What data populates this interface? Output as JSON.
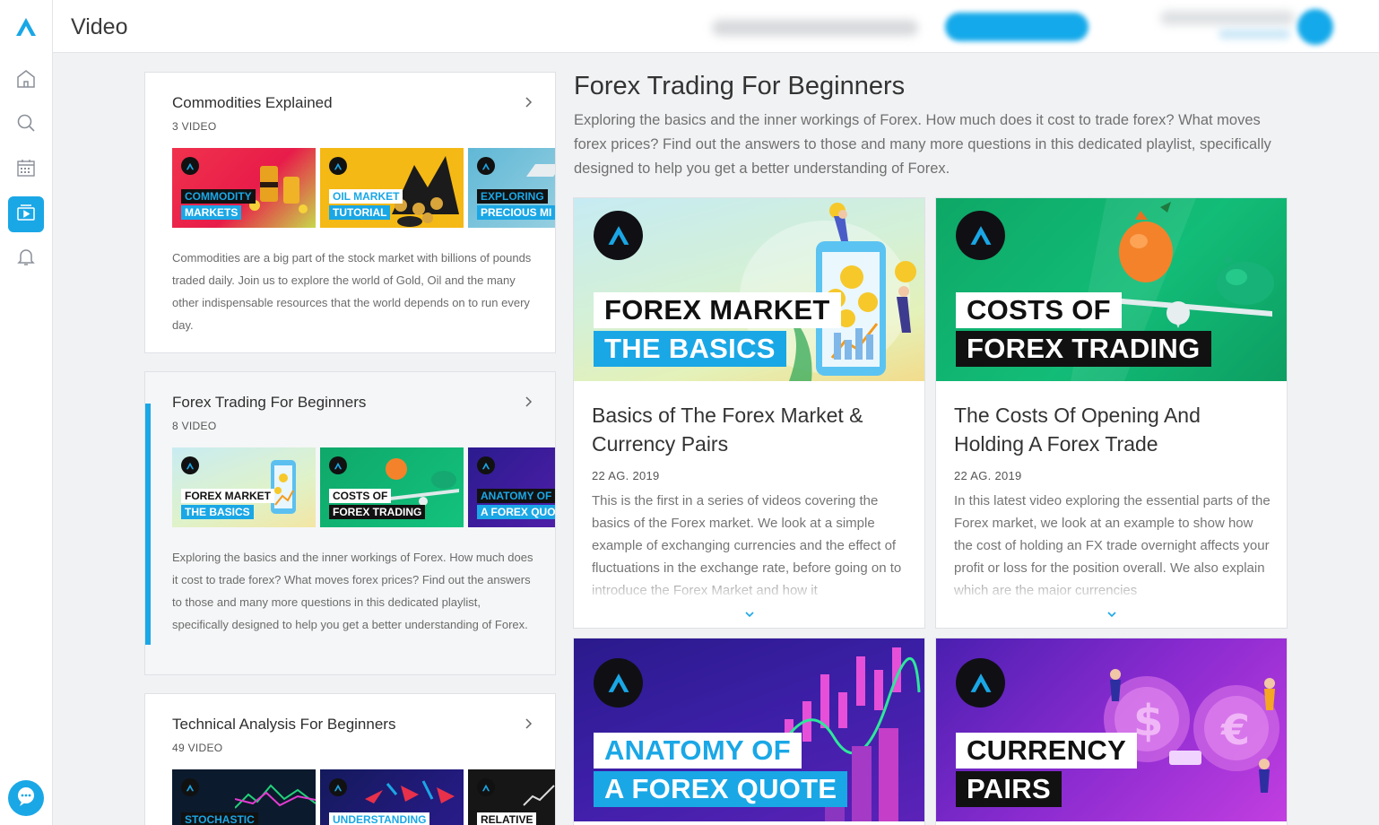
{
  "app": {
    "page_title": "Video",
    "accent": "#1aa7e6"
  },
  "nav": [
    {
      "name": "home-icon"
    },
    {
      "name": "search-icon"
    },
    {
      "name": "calendar-icon"
    },
    {
      "name": "video-icon",
      "active": true
    },
    {
      "name": "bell-icon"
    }
  ],
  "playlists": [
    {
      "title": "Commodities Explained",
      "count": "3 VIDEO",
      "description": "Commodities are a big part of the stock market with billions of pounds traded daily. Join us to explore the world of Gold, Oil and the many other indispensable resources that the world depends on to run every day.",
      "thumbs": [
        {
          "line1": "COMMODITY",
          "line2": "MARKETS"
        },
        {
          "line1": "OIL MARKET",
          "line2": "TUTORIAL"
        },
        {
          "line1": "EXPLORING",
          "line2": "PRECIOUS MI"
        }
      ]
    },
    {
      "title": "Forex Trading For Beginners",
      "count": "8 VIDEO",
      "description": "Exploring the basics and the inner workings of Forex. How much does it cost to trade forex? What moves forex prices? Find out the answers to those and many more questions in this dedicated playlist, specifically designed to help you get a better understanding of Forex.",
      "thumbs": [
        {
          "line1": "FOREX MARKET",
          "line2": "THE BASICS"
        },
        {
          "line1": "COSTS OF",
          "line2": "FOREX TRADING"
        },
        {
          "line1": "ANATOMY OF",
          "line2": "A FOREX QUO"
        }
      ]
    },
    {
      "title": "Technical Analysis For Beginners",
      "count": "49 VIDEO",
      "thumbs": [
        {
          "line1": "STOCHASTIC"
        },
        {
          "line1": "UNDERSTANDING"
        },
        {
          "line1": "RELATIVE"
        }
      ]
    }
  ],
  "main": {
    "title": "Forex Trading For Beginners",
    "description": "Exploring the basics and the inner workings of Forex. How much does it cost to trade forex? What moves forex prices? Find out the answers to those and many more questions in this dedicated playlist, specifically designed to help you get a better understanding of Forex.",
    "videos": [
      {
        "overlay1": "FOREX MARKET",
        "overlay2": "THE BASICS",
        "title": "Basics of The Forex Market & Currency Pairs",
        "date": "22 AG. 2019",
        "description": "This is the first in a series of videos covering the basics of the Forex market. We look at a simple example of exchanging currencies and the effect of fluctuations in the exchange rate, before going on to introduce the Forex Market and how it"
      },
      {
        "overlay1": "COSTS OF",
        "overlay2": "FOREX TRADING",
        "title": "The Costs Of Opening And Holding A Forex Trade",
        "date": "22 AG. 2019",
        "description": "In this latest video exploring the essential parts of the Forex market, we look at an example to show how the cost of holding an FX trade overnight affects your profit or loss for the position overall. We also explain which are the major currencies"
      },
      {
        "overlay1": "ANATOMY OF",
        "overlay2": "A FOREX QUOTE"
      },
      {
        "overlay1": "CURRENCY",
        "overlay2": "PAIRS"
      }
    ]
  }
}
